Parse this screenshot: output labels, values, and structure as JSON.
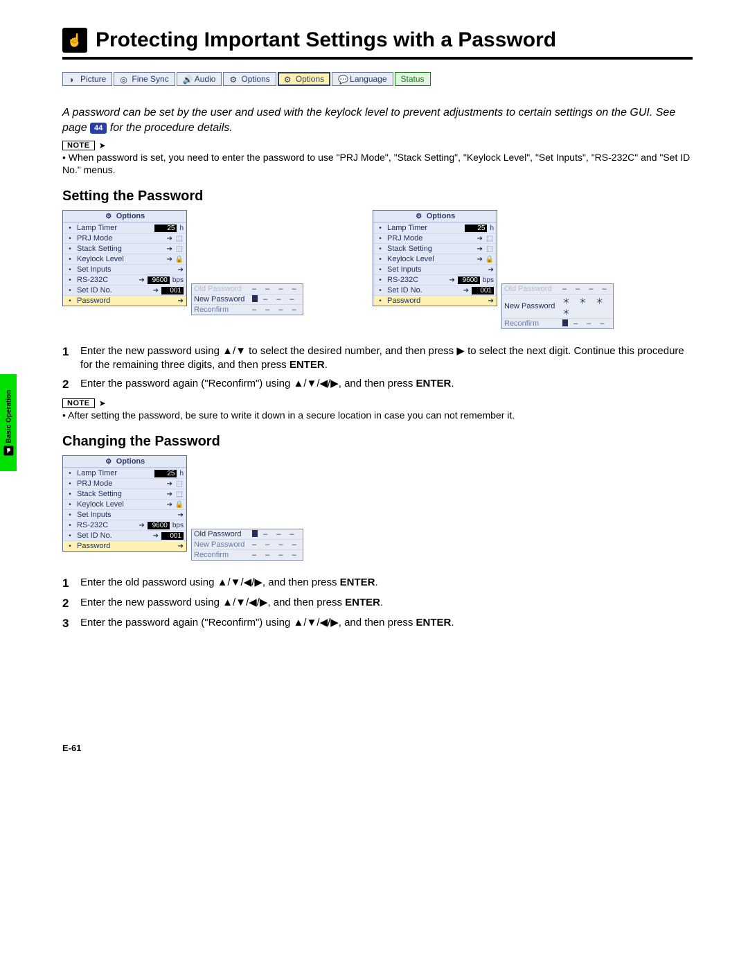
{
  "sideTab": {
    "label": "Basic Operation"
  },
  "title": "Protecting Important Settings with a Password",
  "tabs": [
    {
      "label": "Picture"
    },
    {
      "label": "Fine Sync"
    },
    {
      "label": "Audio"
    },
    {
      "label": "Options"
    },
    {
      "label": "Options",
      "selected": true
    },
    {
      "label": "Language"
    },
    {
      "label": "Status",
      "status": true
    }
  ],
  "intro": {
    "pre": "A password can be set by the user and used with the keylock level to prevent adjustments to certain settings on the GUI. See page ",
    "ref": "44",
    "post": " for the procedure details."
  },
  "note1": {
    "tag": "NOTE",
    "body": "When password is set, you need to enter the password to use \"PRJ Mode\", \"Stack Setting\", \"Keylock Level\", \"Set Inputs\", \"RS-232C\" and \"Set ID No.\" menus."
  },
  "section1": "Setting the Password",
  "osd": {
    "title": "Options",
    "rows": [
      {
        "icon": "lamp-icon",
        "label": "Lamp Timer",
        "value": "25",
        "unit": "h"
      },
      {
        "icon": "screen-icon",
        "label": "PRJ Mode",
        "arrowGlyph": "⬚"
      },
      {
        "icon": "stack-icon",
        "label": "Stack Setting",
        "arrowGlyph": "⬚"
      },
      {
        "icon": "lock-icon",
        "label": "Keylock Level",
        "arrowGlyph": "🔒"
      },
      {
        "icon": "inputs-icon",
        "label": "Set Inputs",
        "arrowOnly": true
      },
      {
        "icon": "port-icon",
        "label": "RS-232C",
        "value": "9600",
        "unit": "bps",
        "hasArrow": true
      },
      {
        "icon": "id-icon",
        "label": "Set ID No.",
        "value": "001",
        "hasArrow": true
      },
      {
        "icon": "key-icon",
        "label": "Password",
        "highlight": true,
        "arrowOnly": true
      }
    ]
  },
  "pwPanelA": {
    "rows": [
      {
        "label": "Old Password",
        "state": "dim",
        "values": "– – – –"
      },
      {
        "label": "New Password",
        "state": "active",
        "cursor": true,
        "values": "– – –"
      },
      {
        "label": "Reconfirm",
        "state": "plain",
        "values": "– – – –"
      }
    ]
  },
  "pwPanelB": {
    "rows": [
      {
        "label": "Old Password",
        "state": "dim",
        "values": "– – – –"
      },
      {
        "label": "New Password",
        "state": "active",
        "values": "＊ ＊ ＊ ＊"
      },
      {
        "label": "Reconfirm",
        "state": "plain",
        "cursor": true,
        "values": "– – –"
      }
    ]
  },
  "steps1": [
    {
      "n": "1",
      "pre": "Enter the new password using ",
      "sym": "▲/▼",
      "mid": " to select the desired number, and then press ",
      "sym2": "▶",
      "post": " to select the next digit. Continue this procedure for the remaining three digits, and then press ",
      "bold": "ENTER",
      "tail": "."
    },
    {
      "n": "2",
      "pre": "Enter the password again (\"Reconfirm\") using ",
      "sym": "▲/▼/◀/▶",
      "mid": ", and then press ",
      "bold": "ENTER",
      "tail": "."
    }
  ],
  "note2": {
    "tag": "NOTE",
    "body": "After setting the password, be sure to write it down in a secure location in case you can not remember it."
  },
  "section2": "Changing the Password",
  "pwPanelC": {
    "rows": [
      {
        "label": "Old Password",
        "state": "active",
        "cursor": true,
        "values": "– – –"
      },
      {
        "label": "New Password",
        "state": "plain",
        "values": "– – – –"
      },
      {
        "label": "Reconfirm",
        "state": "plain",
        "values": "– – – –"
      }
    ]
  },
  "steps2": [
    {
      "n": "1",
      "pre": "Enter the old password using ",
      "sym": "▲/▼/◀/▶",
      "mid": ", and then press ",
      "bold": "ENTER",
      "tail": "."
    },
    {
      "n": "2",
      "pre": "Enter the new password using ",
      "sym": "▲/▼/◀/▶",
      "mid": ", and then press ",
      "bold": "ENTER",
      "tail": "."
    },
    {
      "n": "3",
      "pre": "Enter the password again (\"Reconfirm\") using ",
      "sym": "▲/▼/◀/▶",
      "mid": ", and then press ",
      "bold": "ENTER",
      "tail": "."
    }
  ],
  "pageNum": "E-61"
}
